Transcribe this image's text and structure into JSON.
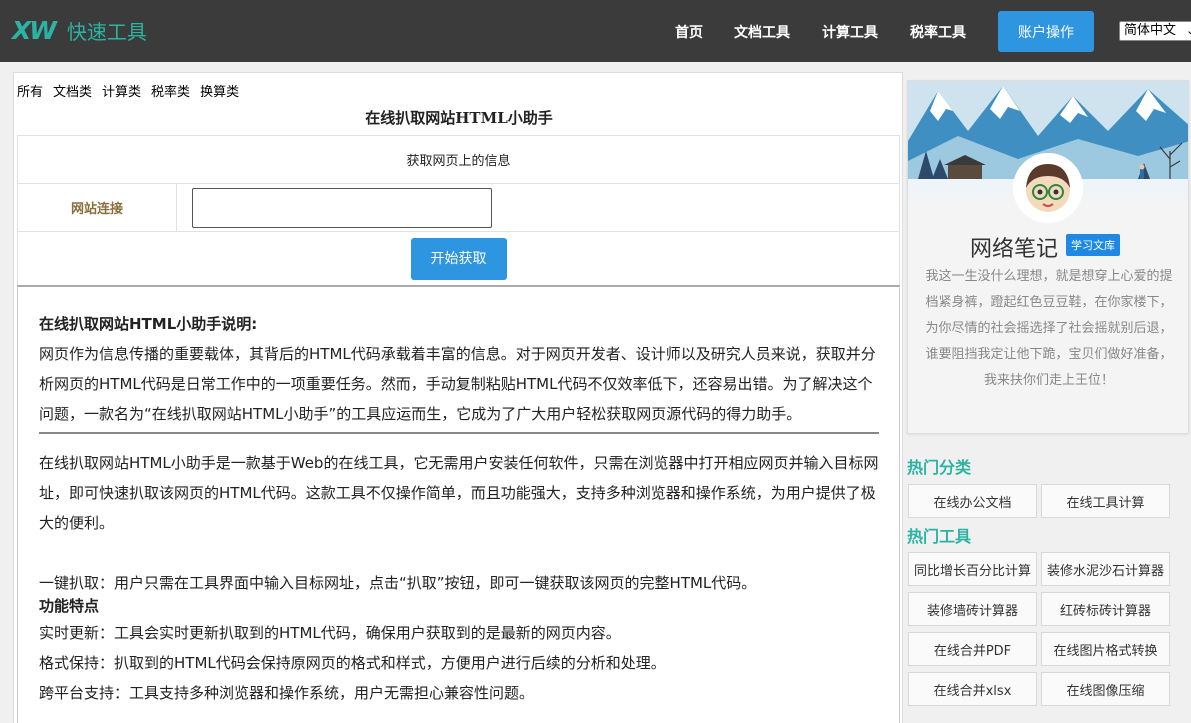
{
  "header": {
    "logo_mark": "XW",
    "logo_text": "快速工具",
    "nav": [
      "首页",
      "文档工具",
      "计算工具",
      "税率工具"
    ],
    "account_button": "账户操作",
    "language": "简体中文"
  },
  "main": {
    "categories": [
      "所有",
      "文档类",
      "计算类",
      "税率类",
      "换算类"
    ],
    "tool_title": "在线扒取网站HTML小助手",
    "info_row": "获取网页上的信息",
    "url_label": "网站连接",
    "url_value": "",
    "start_button": "开始获取",
    "description": {
      "heading": "在线扒取网站HTML小助手说明:",
      "intro": "网页作为信息传播的重要载体，其背后的HTML代码承载着丰富的信息。对于网页开发者、设计师以及研究人员来说，获取并分析网页的HTML代码是日常工作中的一项重要任务。然而，手动复制粘贴HTML代码不仅效率低下，还容易出错。为了解决这个问题，一款名为“在线扒取网站HTML小助手”的工具应运而生，它成为了广大用户轻松获取网页源代码的得力助手。",
      "para2": "在线扒取网站HTML小助手是一款基于Web的在线工具，它无需用户安装任何软件，只需在浏览器中打开相应网页并输入目标网址，即可快速扒取该网页的HTML代码。这款工具不仅操作简单，而且功能强大，支持多种浏览器和操作系统，为用户提供了极大的便利。",
      "line_oneclick": "一键扒取：用户只需在工具界面中输入目标网址，点击“扒取”按钮，即可一键获取该网页的完整HTML代码。",
      "features_heading": "功能特点",
      "line_realtime": "实时更新：工具会实时更新扒取到的HTML代码，确保用户获取到的是最新的网页内容。",
      "line_format": "格式保持：扒取到的HTML代码会保持原网页的格式和样式，方便用户进行后续的分析和处理。",
      "line_cross": "跨平台支持：工具支持多种浏览器和操作系统，用户无需担心兼容性问题。"
    }
  },
  "sidebar": {
    "profile_name": "网络笔记",
    "profile_badge": "学习文库",
    "profile_bio": "我这一生没什么理想，就是想穿上心爱的提档紧身裤，蹬起红色豆豆鞋，在你家楼下，为你尽情的社会摇选择了社会摇就别后退，谁要阻挡我定让他下跪，宝贝们做好准备，我来扶你们走上王位！",
    "hot_categories_title": "热门分类",
    "hot_categories": [
      "在线办公文档",
      "在线工具计算"
    ],
    "hot_tools_title": "热门工具",
    "hot_tools": [
      "同比增长百分比计算",
      "装修水泥沙石计算器",
      "装修墙砖计算器",
      "红砖标砖计算器",
      "在线合并PDF",
      "在线图片格式转换",
      "在线合并xlsx",
      "在线图像压缩"
    ]
  },
  "colors": {
    "topbar": "#3b3b3b",
    "accent_teal": "#2bb3a3",
    "button_blue": "#2e95e0",
    "label_brown": "#8a6d3b"
  }
}
